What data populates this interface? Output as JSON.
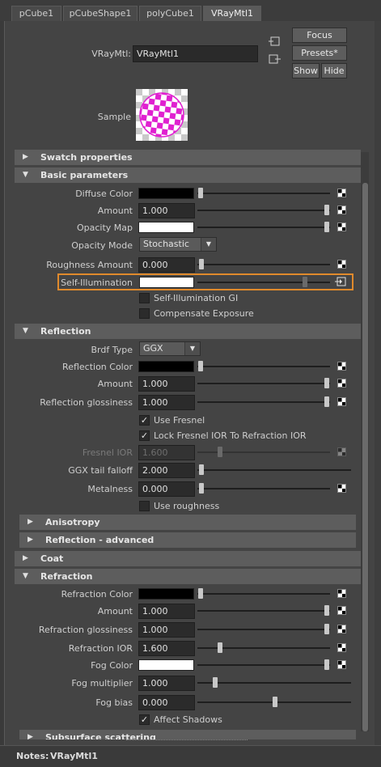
{
  "tabs": [
    {
      "label": "pCube1"
    },
    {
      "label": "pCubeShape1"
    },
    {
      "label": "polyCube1"
    },
    {
      "label": "VRayMtl1"
    }
  ],
  "header": {
    "vraymtl_label": "VRayMtl:",
    "vraymtl_value": "VRayMtl1",
    "focus_label": "Focus",
    "presets_label": "Presets*",
    "show_label": "Show",
    "hide_label": "Hide",
    "sample_label": "Sample"
  },
  "sections": {
    "swatch": "Swatch properties",
    "basic": "Basic parameters",
    "reflection": "Reflection",
    "anisotropy": "Anisotropy",
    "reflection_adv": "Reflection - advanced",
    "coat": "Coat",
    "refraction": "Refraction",
    "subsurface": "Subsurface scattering"
  },
  "basic": {
    "diffuse_color": "Diffuse Color",
    "amount_label": "Amount",
    "amount_value": "1.000",
    "opacity_map": "Opacity Map",
    "opacity_mode_label": "Opacity Mode",
    "opacity_mode_value": "Stochastic",
    "roughness_label": "Roughness Amount",
    "roughness_value": "0.000",
    "self_illum": "Self-Illumination",
    "self_illum_gi": "Self-Illumination GI",
    "compensate": "Compensate Exposure"
  },
  "reflection": {
    "brdf_label": "Brdf Type",
    "brdf_value": "GGX",
    "color_label": "Reflection Color",
    "amount_label": "Amount",
    "amount_value": "1.000",
    "gloss_label": "Reflection glossiness",
    "gloss_value": "1.000",
    "use_fresnel": "Use Fresnel",
    "lock_fresnel": "Lock Fresnel IOR To Refraction IOR",
    "fresnel_ior_label": "Fresnel IOR",
    "fresnel_ior_value": "1.600",
    "ggx_label": "GGX tail falloff",
    "ggx_value": "2.000",
    "metal_label": "Metalness",
    "metal_value": "0.000",
    "use_roughness": "Use roughness"
  },
  "refraction": {
    "color_label": "Refraction Color",
    "amount_label": "Amount",
    "amount_value": "1.000",
    "gloss_label": "Refraction glossiness",
    "gloss_value": "1.000",
    "ior_label": "Refraction IOR",
    "ior_value": "1.600",
    "fog_color_label": "Fog Color",
    "fog_mult_label": "Fog multiplier",
    "fog_mult_value": "1.000",
    "fog_bias_label": "Fog bias",
    "fog_bias_value": "0.000",
    "affect_shadows": "Affect Shadows"
  },
  "notes": {
    "label": "Notes:",
    "value": "VRayMtl1"
  },
  "colors": {
    "highlight": "#e08a2c",
    "sample_magenta": "#e020d0"
  }
}
